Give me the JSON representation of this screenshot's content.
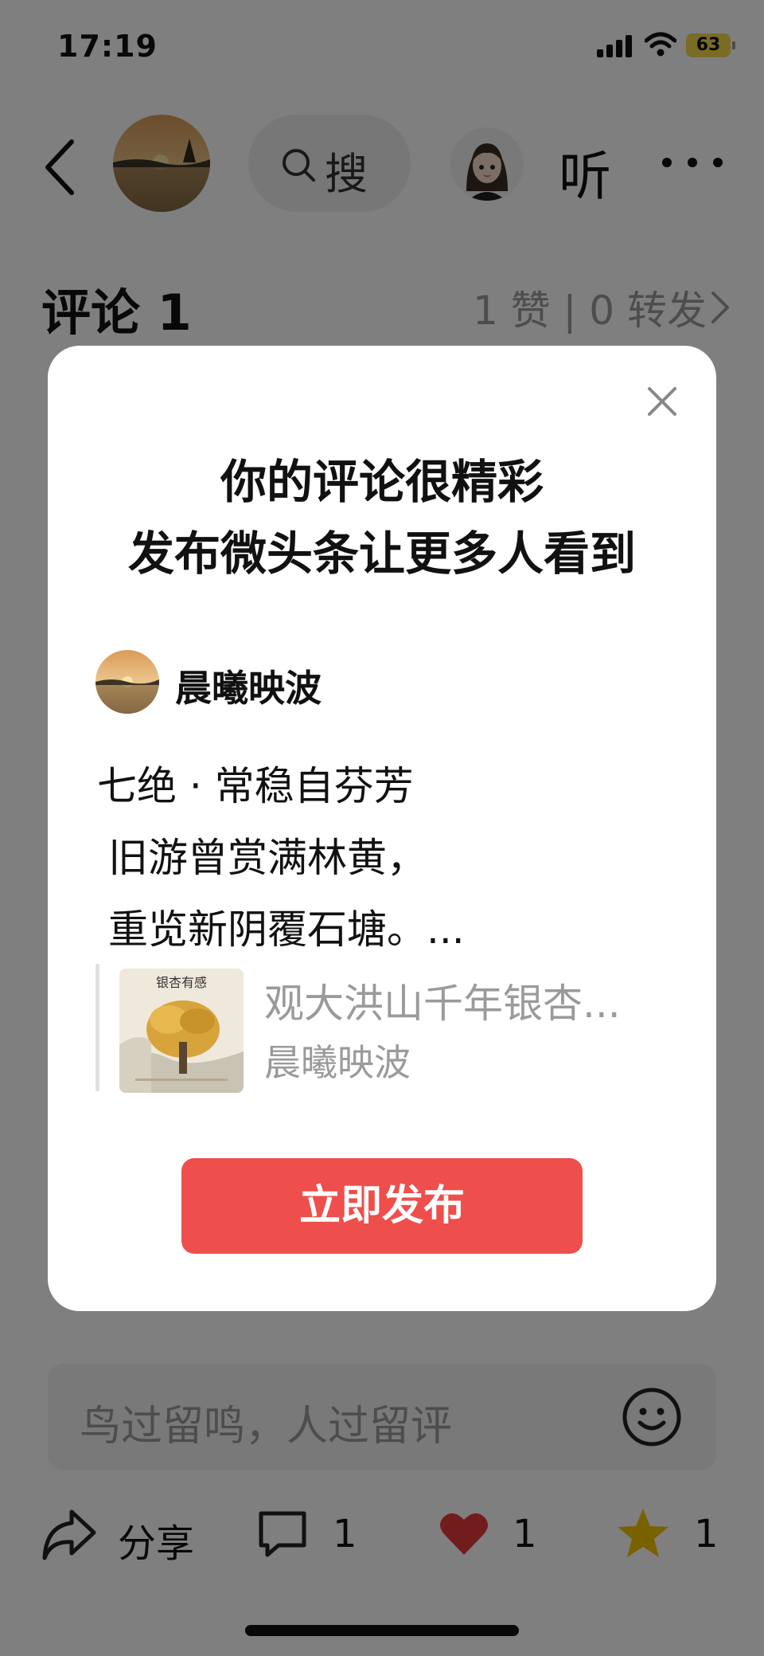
{
  "status_bar": {
    "time": "17:19",
    "battery": "63",
    "battery_color": "#f6d94a"
  },
  "top_bar": {
    "search_label": "搜",
    "listen_label": "听",
    "icons": [
      "back-icon",
      "search-icon",
      "more-icon"
    ]
  },
  "comment_header": {
    "title": "评论 1",
    "stats": "1 赞 | 0 转发"
  },
  "modal": {
    "title_line1": "你的评论很精彩",
    "title_line2": "发布微头条让更多人看到",
    "author_name": "晨曦映波",
    "poem": {
      "line1": "七绝 · 常稳自芬芳",
      "line2": "旧游曾赏满林黄，",
      "line3": "重览新阴覆石塘。..."
    },
    "quoted_post": {
      "title": "观大洪山千年银杏...",
      "author": "晨曦映波",
      "thumbnail_caption": "银杏有感"
    },
    "publish_button": "立即发布",
    "accent_color": "#ee4f4c"
  },
  "comment_input": {
    "placeholder": "鸟过留鸣，人过留评"
  },
  "bottom_bar": {
    "share_label": "分享",
    "comment_count": "1",
    "like_count": "1",
    "favorite_count": "1",
    "like_color": "#e23a3a",
    "favorite_color": "#f2c200"
  }
}
